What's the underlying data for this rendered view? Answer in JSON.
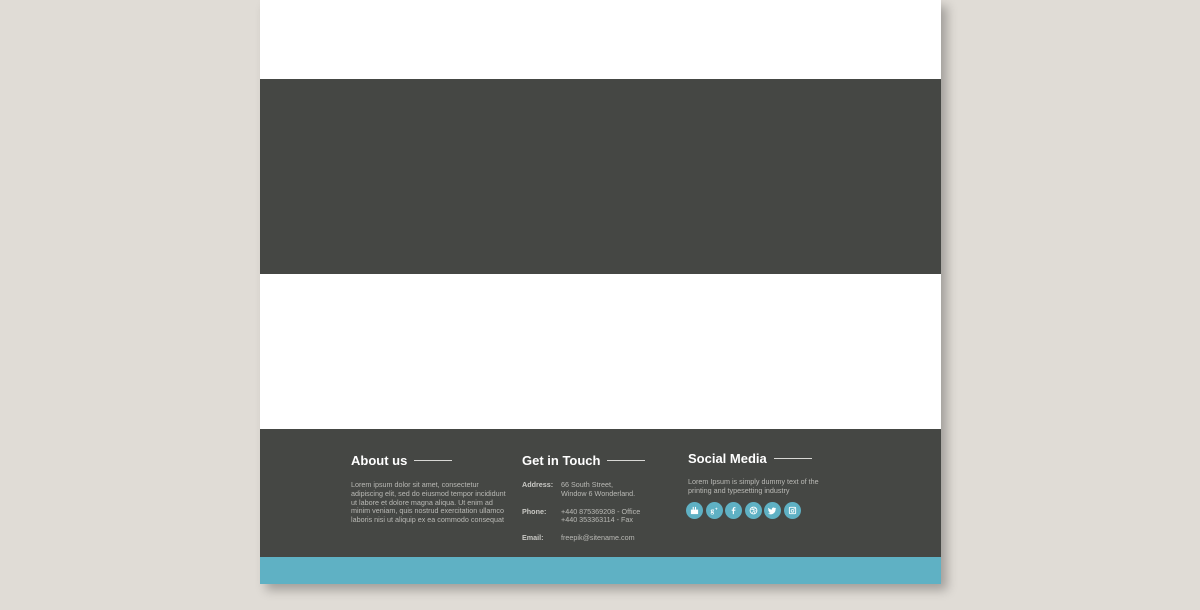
{
  "colors": {
    "background": "#e0dcd6",
    "page": "#ffffff",
    "dark": "#454744",
    "accent": "#5fb1c4"
  },
  "footer": {
    "about": {
      "title": "About us",
      "text": "Lorem ipsum dolor sit amet, consectetur adipiscing elit, sed do eiusmod tempor incididunt ut labore et dolore magna aliqua. Ut enim ad minim veniam, quis nostrud exercitation ullamco laboris nisi ut aliquip ex ea commodo consequat"
    },
    "contact": {
      "title": "Get in Touch",
      "rows": [
        {
          "label": "Address:",
          "lines": [
            "66 South Street,",
            "Window 6 Wonderland."
          ]
        },
        {
          "label": "Phone:",
          "lines": [
            "+440 875369208 - Office",
            "+440 353363114 - Fax"
          ]
        },
        {
          "label": "Email:",
          "lines": [
            "freepik@sitename.com"
          ]
        }
      ]
    },
    "social": {
      "title": "Social Media",
      "text": "Lorem Ipsum is simply dummy text of the printing and typesetting industry",
      "icons": [
        "youtube-icon",
        "google-plus-icon",
        "facebook-icon",
        "dribbble-icon",
        "twitter-icon",
        "instagram-icon"
      ]
    }
  }
}
